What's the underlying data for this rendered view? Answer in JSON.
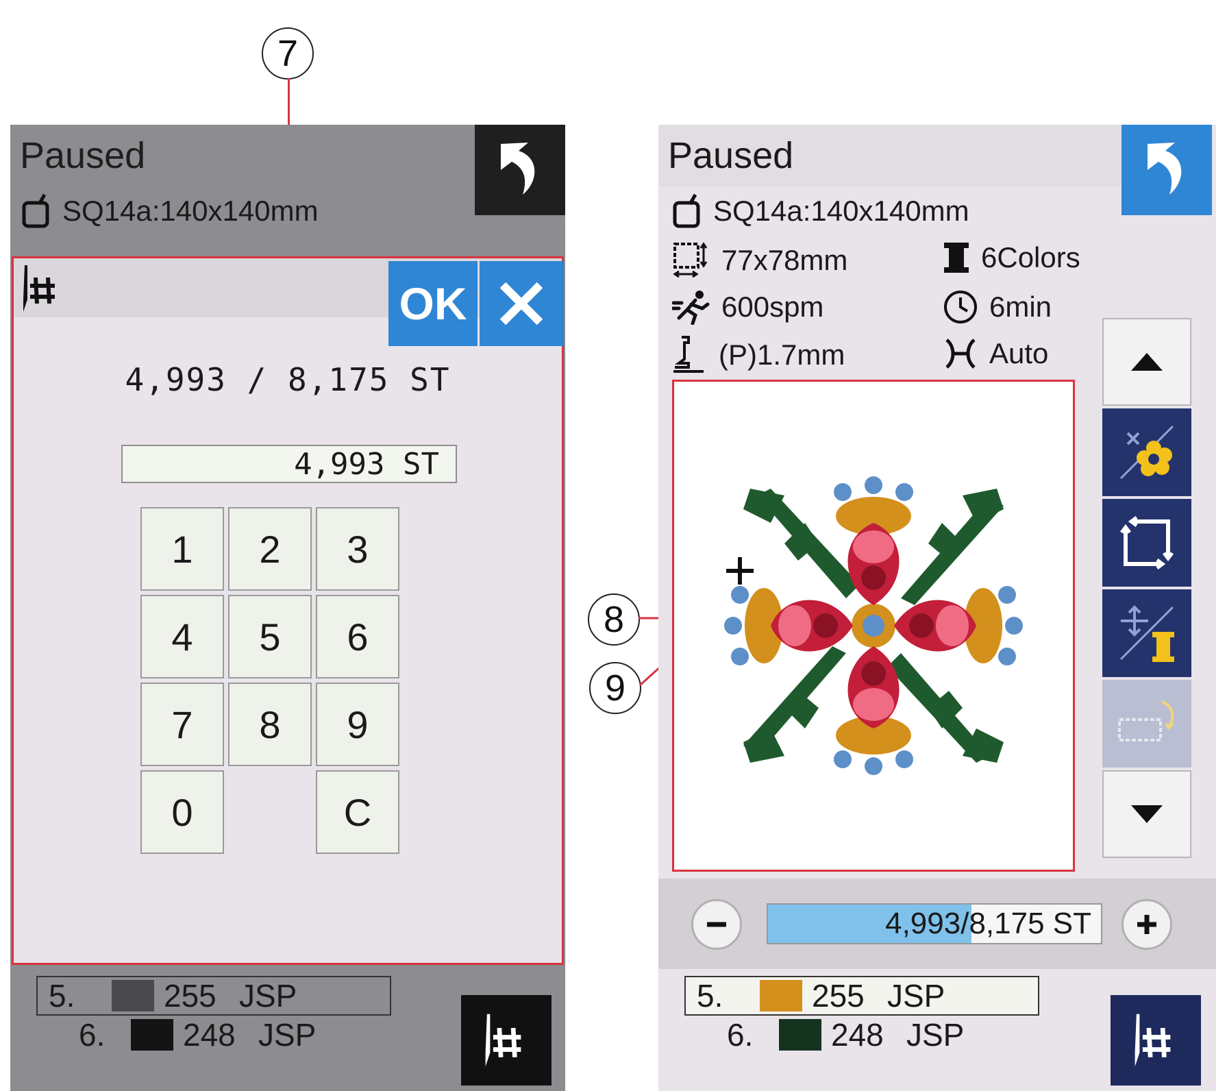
{
  "callouts": {
    "seven": "7",
    "eight": "8",
    "nine": "9"
  },
  "left_screen": {
    "status": "Paused",
    "hoop": "SQ14a:140x140mm",
    "dialog": {
      "summary": "4,993 / 8,175 ST",
      "field_value": "4,993 ST",
      "ok_label": "OK",
      "keys": [
        "1",
        "2",
        "3",
        "4",
        "5",
        "6",
        "7",
        "8",
        "9",
        "0",
        "C"
      ]
    },
    "threads": [
      {
        "num": "5.",
        "code": "255",
        "brand": "JSP",
        "color": "#4a4a4e"
      },
      {
        "num": "6.",
        "code": "248",
        "brand": "JSP",
        "color": "#141414"
      }
    ]
  },
  "right_screen": {
    "status": "Paused",
    "hoop": "SQ14a:140x140mm",
    "size": "77x78mm",
    "colors": "6Colors",
    "speed": "600spm",
    "time": "6min",
    "height": "(P)1.7mm",
    "trim": "Auto",
    "progress": {
      "text": "4,993/8,175 ST",
      "current": 4993,
      "total": 8175
    },
    "threads": [
      {
        "num": "5.",
        "code": "255",
        "brand": "JSP",
        "color": "#d4901d"
      },
      {
        "num": "6.",
        "code": "248",
        "brand": "JSP",
        "color": "#163320"
      }
    ]
  },
  "accent_colors": {
    "blue": "#2f86d4",
    "navy": "#24336b",
    "red": "#d9333f"
  }
}
